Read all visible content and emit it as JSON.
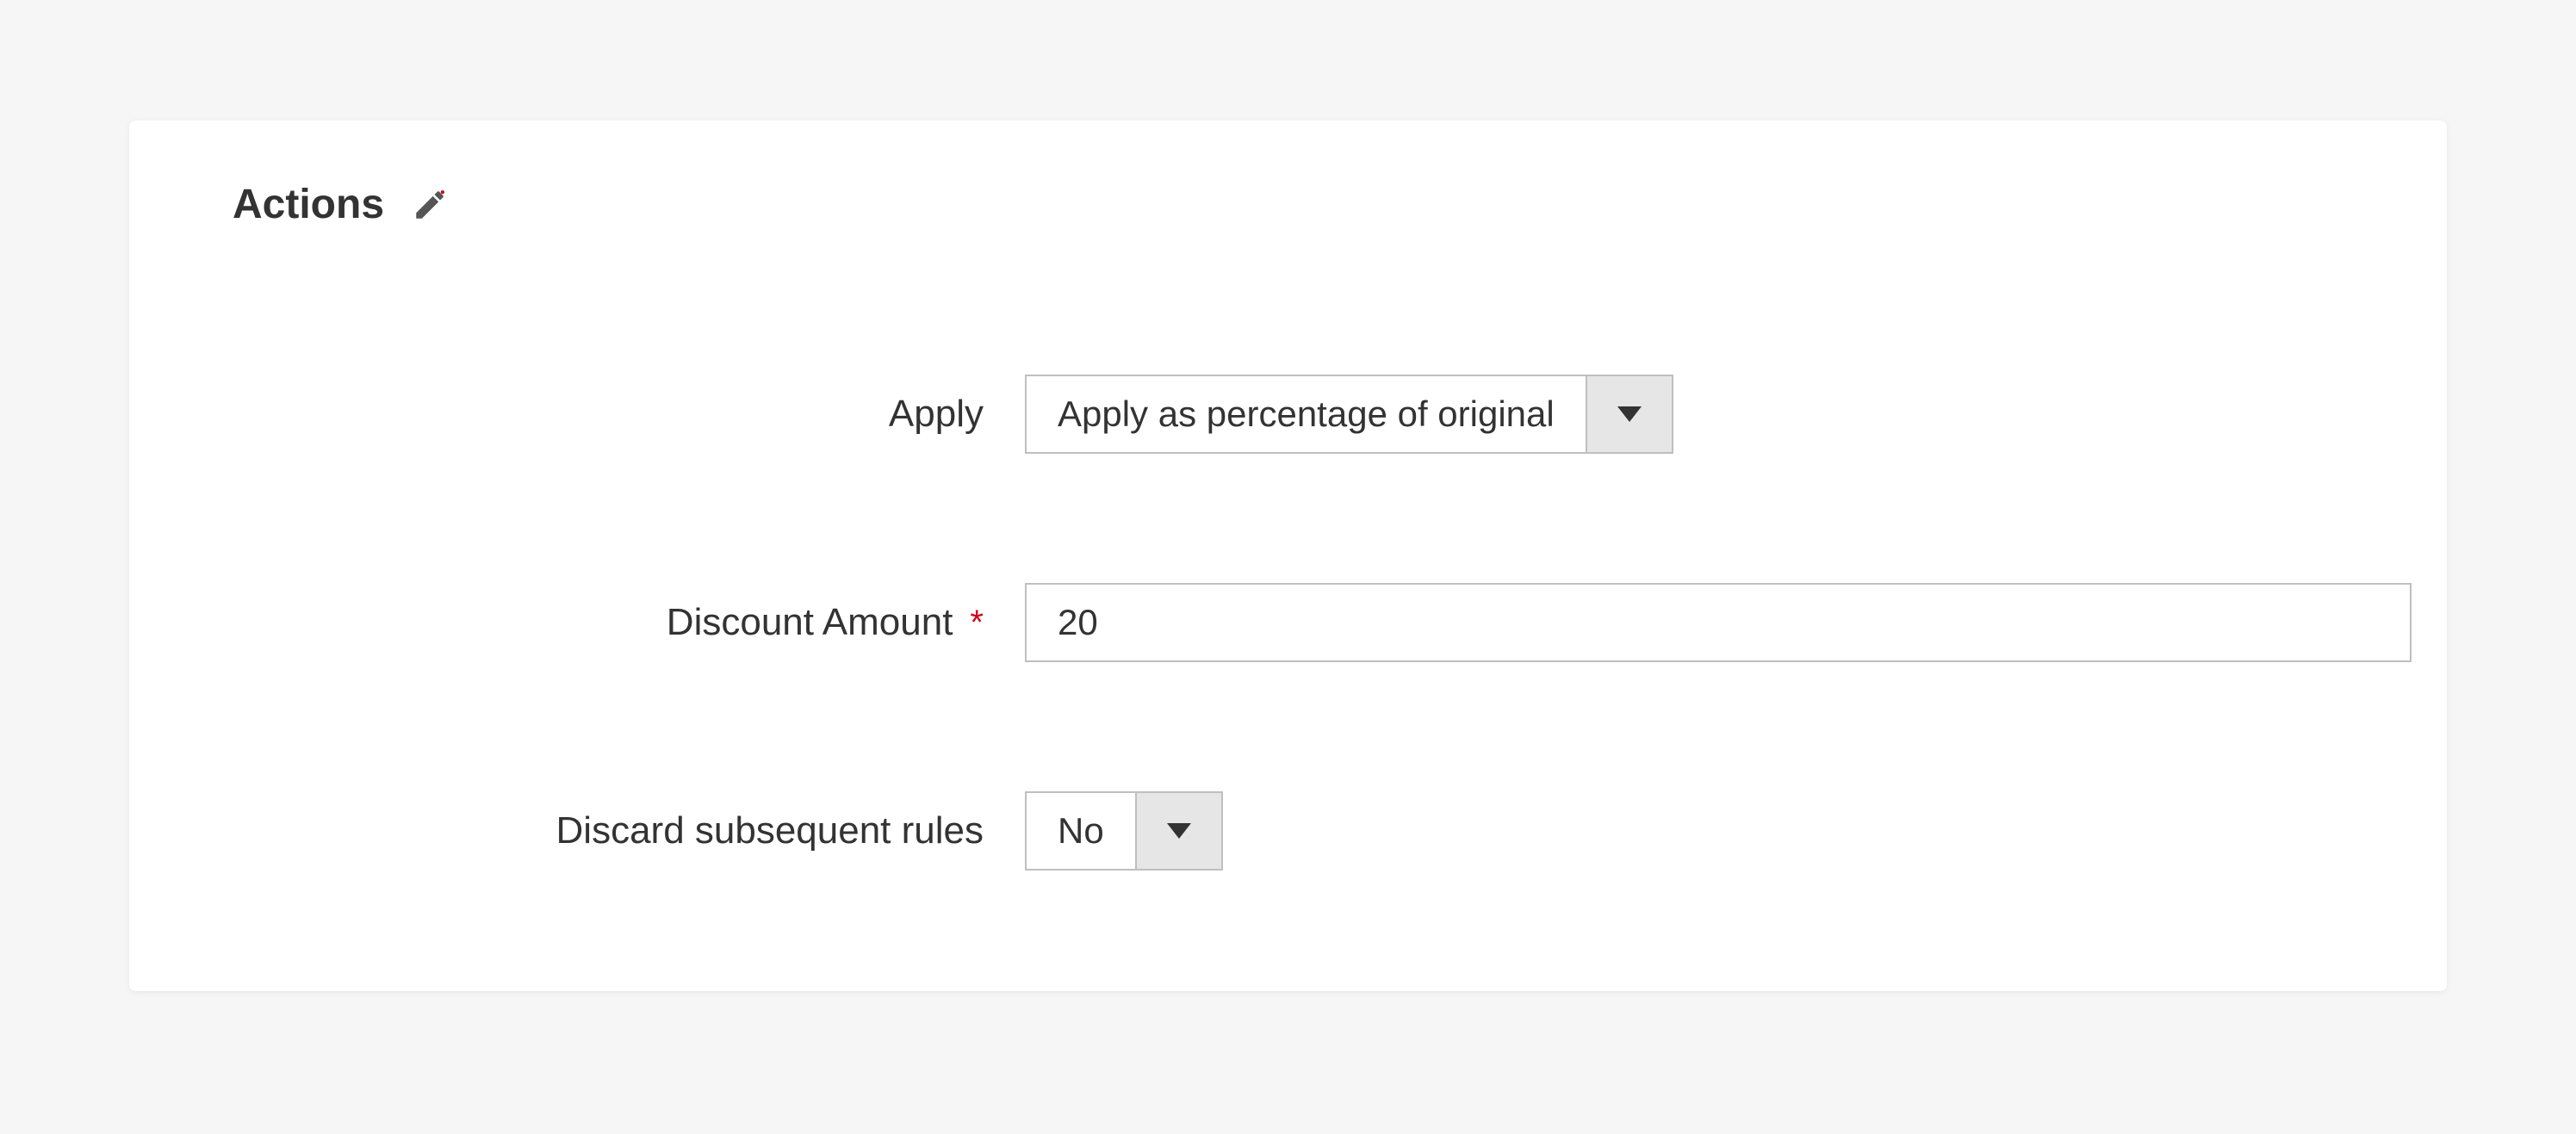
{
  "section": {
    "title": "Actions"
  },
  "fields": {
    "apply": {
      "label": "Apply",
      "value": "Apply as percentage of original"
    },
    "discountAmount": {
      "label": "Discount Amount",
      "required": "*",
      "value": "20"
    },
    "discardSubsequent": {
      "label": "Discard subsequent rules",
      "value": "No"
    }
  }
}
